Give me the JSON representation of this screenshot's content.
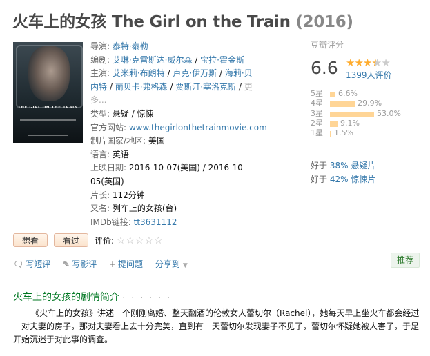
{
  "title": {
    "main": "火车上的女孩 The Girl on the Train",
    "year": "(2016)"
  },
  "poster": {
    "alt": "THE GIRL ON THE TRAIN"
  },
  "info": {
    "director_label": "导演: ",
    "director": "泰特·泰勒",
    "writer_label": "编剧: ",
    "writers": [
      "艾琳·克雷斯达·威尔森",
      "宝拉·霍金斯"
    ],
    "cast_label": "主演: ",
    "cast": [
      "艾米莉·布朗特",
      "卢克·伊万斯",
      "海莉·贝内特",
      "丽贝卡·弗格森",
      "贾斯汀·塞洛克斯"
    ],
    "cast_more": "更多...",
    "genre_label": "类型: ",
    "genre": "悬疑 / 惊悚",
    "site_label": "官方网站: ",
    "site": "www.thegirlonthetrainmovie.com",
    "country_label": "制片国家/地区: ",
    "country": "美国",
    "lang_label": "语言: ",
    "lang": "英语",
    "release_label": "上映日期: ",
    "release": "2016-10-07(美国) / 2016-10-05(英国)",
    "runtime_label": "片长: ",
    "runtime": "112分钟",
    "aka_label": "又名: ",
    "aka": "列车上的女孩(台)",
    "imdb_label": "IMDb链接: ",
    "imdb": "tt3631112"
  },
  "rating": {
    "label": "豆瓣评分",
    "score": "6.6",
    "stars_filled": 3.5,
    "votes": "1399人评价",
    "distribution": [
      {
        "star": "5星",
        "pct": "6.6%",
        "value": 6.6
      },
      {
        "star": "4星",
        "pct": "29.9%",
        "value": 29.9
      },
      {
        "star": "3星",
        "pct": "53.0%",
        "value": 53.0
      },
      {
        "star": "2星",
        "pct": "9.1%",
        "value": 9.1
      },
      {
        "star": "1星",
        "pct": "1.5%",
        "value": 1.5
      }
    ],
    "better1_prefix": "好于 ",
    "better1_link": "38% 悬疑片",
    "better2_prefix": "好于 ",
    "better2_link": "42% 惊悚片"
  },
  "actions": {
    "want": "想看",
    "seen": "看过",
    "rate_label": "评价:",
    "short_review": "写短评",
    "review": "写影评",
    "question": "提问题",
    "share": "分享到",
    "recommend": "推荐"
  },
  "intro": {
    "heading": "火车上的女孩的剧情简介",
    "dots": "· · · · · ·",
    "text": "《火车上的女孩》讲述一个刚刚离婚、整天酗酒的伦敦女人蕾切尔（Rachel），她每天早上坐火车都会经过一对夫妻的房子，那对夫妻看上去十分完美，直到有一天蕾切尔发现妻子不见了，蕾切尔怀疑她被人害了，于是开始沉迷于对此事的调查。"
  },
  "colors": {
    "link": "#3377aa",
    "accent_green": "#007722",
    "star": "#ffac2d",
    "bar": "#ffd596"
  }
}
